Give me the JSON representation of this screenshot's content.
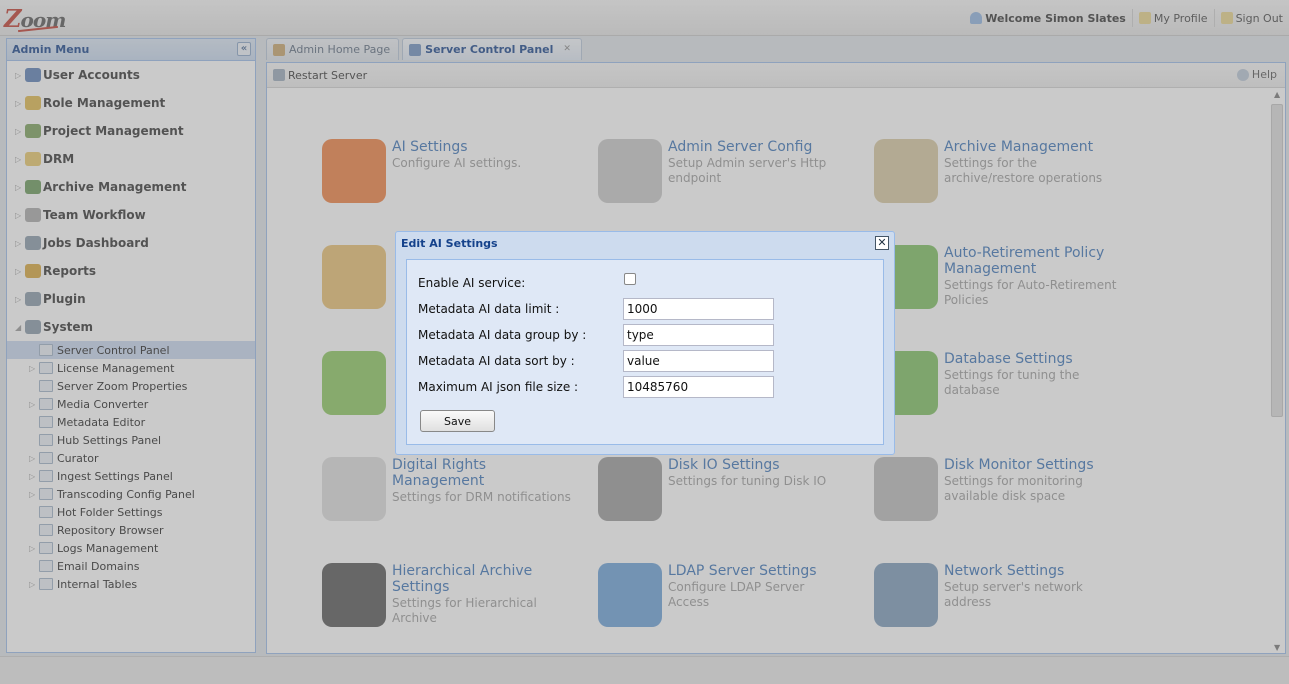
{
  "app": {
    "logo_text": "oom",
    "logo_initial": "Z"
  },
  "header": {
    "welcome": "Welcome Simon Slates",
    "my_profile": "My Profile",
    "sign_out": "Sign Out"
  },
  "menu": {
    "title": "Admin Menu",
    "collapse_glyph": "«",
    "items": [
      {
        "label": "User Accounts",
        "color": "#5b7fb5"
      },
      {
        "label": "Role Management",
        "color": "#e0b84a"
      },
      {
        "label": "Project Management",
        "color": "#7aa05a"
      },
      {
        "label": "DRM",
        "color": "#e8c96a"
      },
      {
        "label": "Archive Management",
        "color": "#6a9a5a"
      },
      {
        "label": "Team Workflow",
        "color": "#aaaaaa"
      },
      {
        "label": "Jobs Dashboard",
        "color": "#8899aa"
      },
      {
        "label": "Reports",
        "color": "#d8a63a"
      },
      {
        "label": "Plugin",
        "color": "#8899aa"
      },
      {
        "label": "System",
        "color": "#8899aa"
      }
    ],
    "system_children": [
      {
        "label": "Server Control Panel",
        "expandable": false
      },
      {
        "label": "License Management",
        "expandable": true
      },
      {
        "label": "Server Zoom Properties",
        "expandable": false
      },
      {
        "label": "Media Converter",
        "expandable": true
      },
      {
        "label": "Metadata Editor",
        "expandable": false
      },
      {
        "label": "Hub Settings Panel",
        "expandable": false
      },
      {
        "label": "Curator",
        "expandable": true
      },
      {
        "label": "Ingest Settings Panel",
        "expandable": true
      },
      {
        "label": "Transcoding Config Panel",
        "expandable": true
      },
      {
        "label": "Hot Folder Settings",
        "expandable": false
      },
      {
        "label": "Repository Browser",
        "expandable": false
      },
      {
        "label": "Logs Management",
        "expandable": true
      },
      {
        "label": "Email Domains",
        "expandable": false
      },
      {
        "label": "Internal Tables",
        "expandable": true
      }
    ]
  },
  "tabs": [
    {
      "label": "Admin Home Page"
    },
    {
      "label": "Server Control Panel"
    }
  ],
  "toolbar": {
    "restart": "Restart Server",
    "help": "Help"
  },
  "tiles": [
    {
      "title": "AI Settings",
      "desc": "Configure AI settings.",
      "icon": "link-icon",
      "color": "#f08040"
    },
    {
      "title": "Admin Server Config",
      "desc": "Setup Admin server's Http endpoint",
      "icon": "power-icon",
      "color": "#c8c8c8"
    },
    {
      "title": "Archive Management",
      "desc": "Settings for the archive/restore operations",
      "icon": "box-icon",
      "color": "#d8c8a0"
    },
    {
      "title": "Auto-Retirement Policy Management",
      "desc": "Settings for Auto-Retirement Policies",
      "icon": "clock-icon",
      "color": "#7cc060"
    },
    {
      "title": "Database Settings",
      "desc": "Settings for tuning the database",
      "icon": "database-icon",
      "color": "#7cc060"
    },
    {
      "title": "Digital Rights Management",
      "desc": "Settings for DRM notifications",
      "icon": "document-lock-icon",
      "color": "#dddddd"
    },
    {
      "title": "Disk IO Settings",
      "desc": "Settings for tuning Disk IO",
      "icon": "hard-drive-icon",
      "color": "#999999"
    },
    {
      "title": "Disk Monitor Settings",
      "desc": "Settings for monitoring available disk space",
      "icon": "disk-monitor-icon",
      "color": "#bbbbbb"
    },
    {
      "title": "Hierarchical Archive Settings",
      "desc": "Settings for Hierarchical Archive",
      "icon": "hierarchy-icon",
      "color": "#555555"
    },
    {
      "title": "LDAP Server Settings",
      "desc": "Configure LDAP Server Access",
      "icon": "ldap-users-icon",
      "color": "#6aa0d8"
    },
    {
      "title": "Network Settings",
      "desc": "Setup server's network address",
      "icon": "network-icon",
      "color": "#7a9ab8"
    }
  ],
  "dialog": {
    "title": "Edit AI Settings",
    "close_glyph": "✕",
    "fields": {
      "enable_label": "Enable AI service:",
      "limit_label": "Metadata AI data limit :",
      "limit_value": "1000",
      "group_label": "Metadata AI data group by :",
      "group_value": "type",
      "sort_label": "Metadata AI data sort by :",
      "sort_value": "value",
      "maxsize_label": "Maximum AI json file size :",
      "maxsize_value": "10485760"
    },
    "save_label": "Save"
  }
}
